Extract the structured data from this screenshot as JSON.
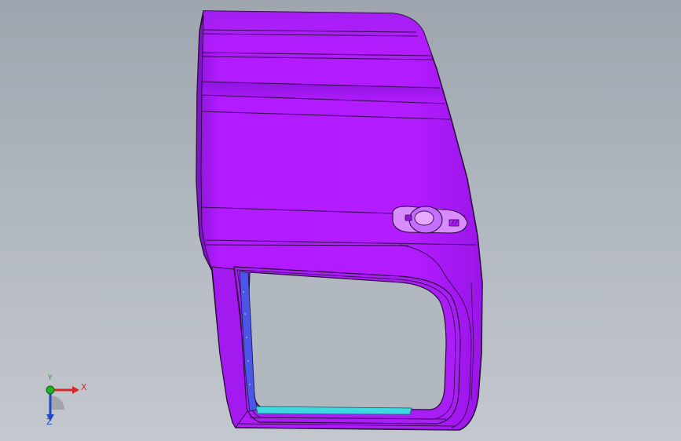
{
  "viewport": {
    "background_top": "#9ea5ae",
    "background_bottom": "#c3c8ce"
  },
  "model": {
    "part": "door-panel",
    "body_color": "#b21aff",
    "edge_color": "#2a0a3a",
    "glass_frame_color": "#4b55e6",
    "sill_color": "#3fd8e0",
    "handle_color": "#d98cff"
  },
  "triad": {
    "x_label": "X",
    "y_label": "Y",
    "z_label": "Z",
    "x_color": "#d8262a",
    "y_color": "#1f9a1f",
    "z_color": "#2146c6"
  }
}
